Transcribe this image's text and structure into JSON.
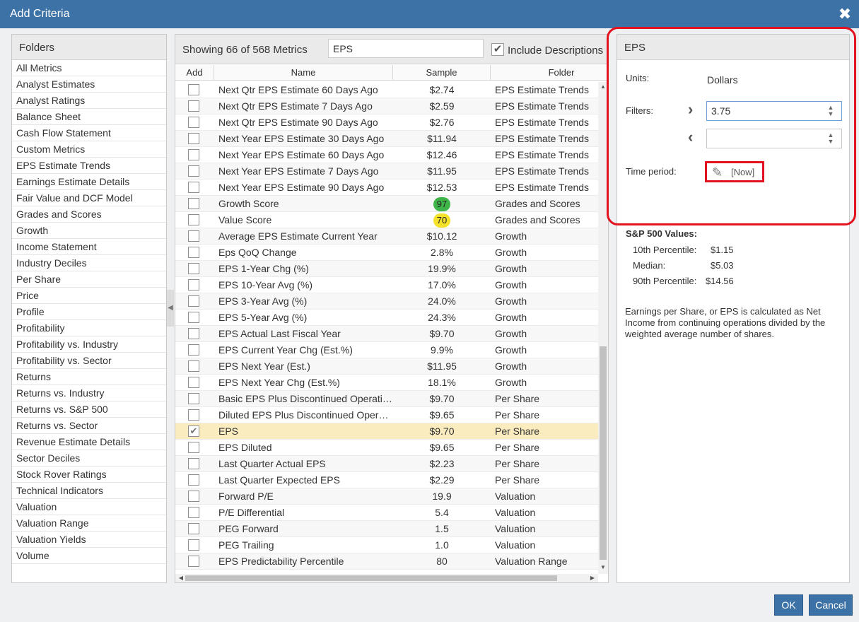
{
  "window": {
    "title": "Add Criteria",
    "close": "✖"
  },
  "folders": {
    "header": "Folders",
    "items": [
      "All Metrics",
      "Analyst Estimates",
      "Analyst Ratings",
      "Balance Sheet",
      "Cash Flow Statement",
      "Custom Metrics",
      "EPS Estimate Trends",
      "Earnings Estimate Details",
      "Fair Value and DCF Model",
      "Grades and Scores",
      "Growth",
      "Income Statement",
      "Industry Deciles",
      "Per Share",
      "Price",
      "Profile",
      "Profitability",
      "Profitability vs. Industry",
      "Profitability vs. Sector",
      "Returns",
      "Returns vs. Industry",
      "Returns vs. S&P 500",
      "Returns vs. Sector",
      "Revenue Estimate Details",
      "Sector Deciles",
      "Stock Rover Ratings",
      "Technical Indicators",
      "Valuation",
      "Valuation Range",
      "Valuation Yields",
      "Volume"
    ]
  },
  "metrics": {
    "showing": "Showing 66 of 568 Metrics",
    "search_value": "EPS",
    "include_descriptions": "Include Descriptions",
    "columns": {
      "add": "Add",
      "name": "Name",
      "sample": "Sample",
      "folder": "Folder"
    },
    "rows": [
      {
        "name": "Next Qtr EPS Estimate 60 Days Ago",
        "sample": "$2.74",
        "folder": "EPS Estimate Trends"
      },
      {
        "name": "Next Qtr EPS Estimate 7 Days Ago",
        "sample": "$2.59",
        "folder": "EPS Estimate Trends"
      },
      {
        "name": "Next Qtr EPS Estimate 90 Days Ago",
        "sample": "$2.76",
        "folder": "EPS Estimate Trends"
      },
      {
        "name": "Next Year EPS Estimate 30 Days Ago",
        "sample": "$11.94",
        "folder": "EPS Estimate Trends"
      },
      {
        "name": "Next Year EPS Estimate 60 Days Ago",
        "sample": "$12.46",
        "folder": "EPS Estimate Trends"
      },
      {
        "name": "Next Year EPS Estimate 7 Days Ago",
        "sample": "$11.95",
        "folder": "EPS Estimate Trends"
      },
      {
        "name": "Next Year EPS Estimate 90 Days Ago",
        "sample": "$12.53",
        "folder": "EPS Estimate Trends"
      },
      {
        "name": "Growth Score",
        "sample": "97",
        "folder": "Grades and Scores",
        "badge": "green"
      },
      {
        "name": "Value Score",
        "sample": "70",
        "folder": "Grades and Scores",
        "badge": "yellow"
      },
      {
        "name": "Average EPS Estimate Current Year",
        "sample": "$10.12",
        "folder": "Growth"
      },
      {
        "name": "Eps QoQ Change",
        "sample": "2.8%",
        "folder": "Growth"
      },
      {
        "name": "EPS 1-Year Chg (%)",
        "sample": "19.9%",
        "folder": "Growth"
      },
      {
        "name": "EPS 10-Year Avg (%)",
        "sample": "17.0%",
        "folder": "Growth"
      },
      {
        "name": "EPS 3-Year Avg (%)",
        "sample": "24.0%",
        "folder": "Growth"
      },
      {
        "name": "EPS 5-Year Avg (%)",
        "sample": "24.3%",
        "folder": "Growth"
      },
      {
        "name": "EPS Actual Last Fiscal Year",
        "sample": "$9.70",
        "folder": "Growth"
      },
      {
        "name": "EPS Current Year Chg (Est.%)",
        "sample": "9.9%",
        "folder": "Growth"
      },
      {
        "name": "EPS Next Year (Est.)",
        "sample": "$11.95",
        "folder": "Growth"
      },
      {
        "name": "EPS Next Year Chg (Est.%)",
        "sample": "18.1%",
        "folder": "Growth"
      },
      {
        "name": "Basic EPS Plus Discontinued Operations",
        "sample": "$9.70",
        "folder": "Per Share"
      },
      {
        "name": "Diluted EPS Plus Discontinued Operati...",
        "sample": "$9.65",
        "folder": "Per Share"
      },
      {
        "name": "EPS",
        "sample": "$9.70",
        "folder": "Per Share",
        "checked": true
      },
      {
        "name": "EPS Diluted",
        "sample": "$9.65",
        "folder": "Per Share"
      },
      {
        "name": "Last Quarter Actual EPS",
        "sample": "$2.23",
        "folder": "Per Share"
      },
      {
        "name": "Last Quarter Expected EPS",
        "sample": "$2.29",
        "folder": "Per Share"
      },
      {
        "name": "Forward P/E",
        "sample": "19.9",
        "folder": "Valuation"
      },
      {
        "name": "P/E Differential",
        "sample": "5.4",
        "folder": "Valuation"
      },
      {
        "name": "PEG Forward",
        "sample": "1.5",
        "folder": "Valuation"
      },
      {
        "name": "PEG Trailing",
        "sample": "1.0",
        "folder": "Valuation"
      },
      {
        "name": "EPS Predictability Percentile",
        "sample": "80",
        "folder": "Valuation Range"
      }
    ]
  },
  "details": {
    "header": "EPS",
    "units_label": "Units:",
    "units_value": "Dollars",
    "filters_label": "Filters:",
    "filter_min": "3.75",
    "filter_max": "",
    "time_period_label": "Time period:",
    "time_period_value": "[Now]",
    "sp500": {
      "title": "S&P 500 Values:",
      "p10_label": "10th Percentile:",
      "p10_value": "$1.15",
      "median_label": "Median:",
      "median_value": "$5.03",
      "p90_label": "90th Percentile:",
      "p90_value": "$14.56"
    },
    "description": "Earnings per Share, or EPS is calculated as Net Income from continuing operations divided by the weighted average number of shares."
  },
  "buttons": {
    "ok": "OK",
    "cancel": "Cancel"
  },
  "colors": {
    "titlebar": "#3d72a6",
    "highlight": "#e2121e",
    "selected_row": "#fbecc0",
    "badge_green": "#3fb549",
    "badge_yellow": "#f4e12a"
  }
}
